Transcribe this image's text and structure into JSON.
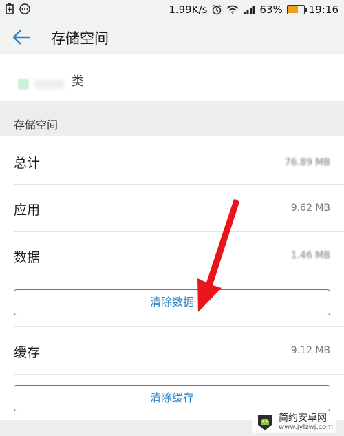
{
  "status_bar": {
    "speed": "1.99K/s",
    "battery_percent": "63%",
    "battery_level": 0.63,
    "time": "19:16"
  },
  "app_bar": {
    "title": "存储空间"
  },
  "app_row": {
    "name_tail": "类"
  },
  "section": {
    "title": "存储空间"
  },
  "rows": {
    "total": {
      "label": "总计",
      "value": "76.89 MB"
    },
    "app": {
      "label": "应用",
      "value": "9.62 MB"
    },
    "data": {
      "label": "数据",
      "value": "1.46 MB"
    },
    "cache": {
      "label": "缓存",
      "value": "9.12 MB"
    }
  },
  "buttons": {
    "clear_data": "清除数据",
    "clear_cache": "清除缓存"
  },
  "watermark": {
    "name": "简约安卓网",
    "site": "www.jylzwj.com"
  },
  "colors": {
    "accent": "#2b84c8",
    "arrow": "#e8161c",
    "header_bg": "#f1f3f1",
    "section_bg": "#eceeec"
  }
}
